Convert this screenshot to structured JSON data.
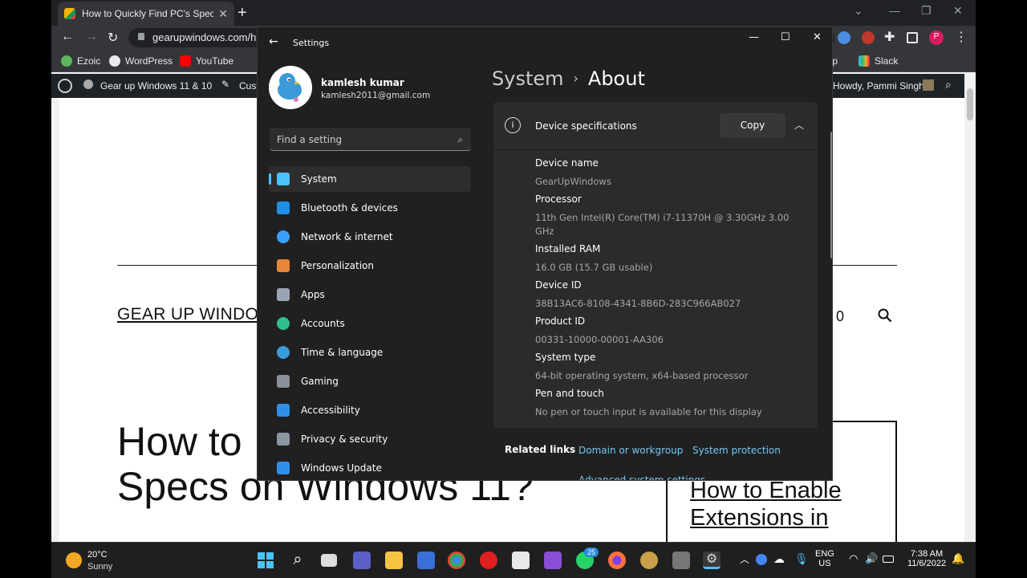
{
  "browser": {
    "tab_title": "How to Quickly Find PC's Specs o",
    "url": "gearupwindows.com/h",
    "bookmarks": [
      "Ezoic",
      "WordPress",
      "YouTube"
    ],
    "bookmarks_right": [
      "eap",
      "Slack"
    ]
  },
  "wp_admin": {
    "site": "Gear up Windows 11 & 10",
    "customize": "Cust",
    "howdy": "Howdy, Pammi Singh"
  },
  "page": {
    "site_title": "GEAR UP WINDOV",
    "nav_tail": "0",
    "article_title_left": "How to",
    "article_title_line2": "Specs on Windows 11?",
    "side_link": "How to Enable Extensions in"
  },
  "settings": {
    "title": "Settings",
    "user_name": "kamlesh kumar",
    "user_email": "kamlesh2011@gmail.com",
    "search_placeholder": "Find a setting",
    "nav": [
      {
        "label": "System",
        "color": "#4cc2ff"
      },
      {
        "label": "Bluetooth & devices",
        "color": "#1f8fe5"
      },
      {
        "label": "Network & internet",
        "color": "#3aa0ff"
      },
      {
        "label": "Personalization",
        "color": "#e8863a"
      },
      {
        "label": "Apps",
        "color": "#9aa4b2"
      },
      {
        "label": "Accounts",
        "color": "#2fbf8f"
      },
      {
        "label": "Time & language",
        "color": "#3a9bdc"
      },
      {
        "label": "Gaming",
        "color": "#8a8f99"
      },
      {
        "label": "Accessibility",
        "color": "#2f8fe8"
      },
      {
        "label": "Privacy & security",
        "color": "#8c96a3"
      },
      {
        "label": "Windows Update",
        "color": "#2f8fe8"
      }
    ],
    "breadcrumb_parent": "System",
    "breadcrumb_sep": "›",
    "page_title": "About",
    "specs_title": "Device specifications",
    "copy_label": "Copy",
    "specs": [
      {
        "label": "Device name",
        "value": "GearUpWindows"
      },
      {
        "label": "Processor",
        "value": "11th Gen Intel(R) Core(TM) i7-11370H @ 3.30GHz   3.00 GHz"
      },
      {
        "label": "Installed RAM",
        "value": "16.0 GB (15.7 GB usable)"
      },
      {
        "label": "Device ID",
        "value": "38B13AC6-8108-4341-8B6D-283C966AB027"
      },
      {
        "label": "Product ID",
        "value": "00331-10000-00001-AA306"
      },
      {
        "label": "System type",
        "value": "64-bit operating system, x64-based processor"
      },
      {
        "label": "Pen and touch",
        "value": "No pen or touch input is available for this display"
      }
    ],
    "related_label": "Related links",
    "related_links": [
      "Domain or workgroup",
      "System protection",
      "Advanced system settings"
    ]
  },
  "taskbar": {
    "temp": "20°C",
    "weather": "Sunny",
    "badge": "25",
    "lang1": "ENG",
    "lang2": "US",
    "time": "7:38 AM",
    "date": "11/6/2022"
  }
}
